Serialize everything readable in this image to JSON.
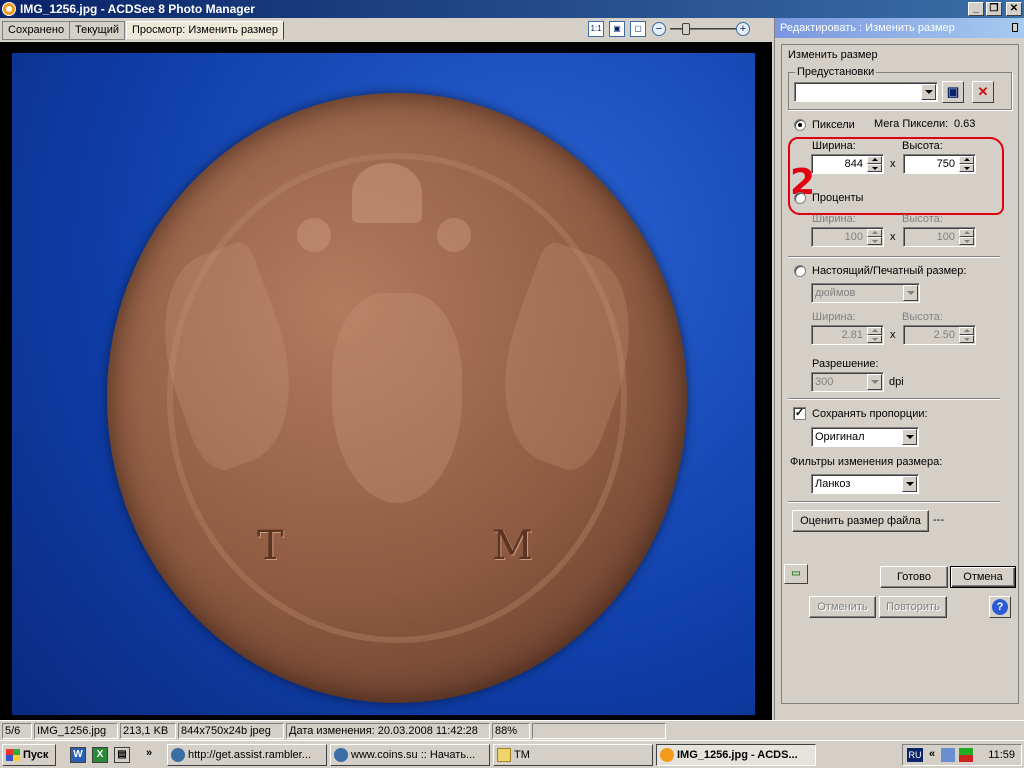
{
  "window": {
    "title": "IMG_1256.jpg - ACDSee 8 Photo Manager",
    "minimize": "_",
    "maximize": "❐",
    "close": "✕"
  },
  "tabs": [
    {
      "label": "Сохранено"
    },
    {
      "label": "Текущий"
    },
    {
      "label": "Просмотр: Изменить размер"
    }
  ],
  "viewtools": {
    "actual_size": "1:1",
    "zoom_out": "−",
    "zoom_in": "+"
  },
  "image": {
    "letter_left": "Т",
    "letter_right": "М"
  },
  "panel": {
    "title": "Редактировать : Изменить размер",
    "section": "Изменить размер",
    "presets_label": "Предустановки",
    "presets_value": "",
    "pixels_label": "Пиксели",
    "megapixels_label": "Мега Пиксели:",
    "megapixels_value": "0.63",
    "width_label": "Ширина:",
    "height_label": "Высота:",
    "px_width": "844",
    "px_height": "750",
    "x_sep": "x",
    "percent_label": "Проценты",
    "pct_width": "100",
    "pct_height": "100",
    "print_label": "Настоящий/Печатный размер:",
    "units_value": "дюймов",
    "print_width": "2.81",
    "print_height": "2.50",
    "resolution_label": "Разрешение:",
    "resolution_value": "300",
    "dpi_label": "dpi",
    "keep_ratio_label": "Сохранять пропорции:",
    "ratio_value": "Оригинал",
    "filters_label": "Фильтры изменения размера:",
    "filter_value": "Ланкоз",
    "estimate_button": "Оценить размер файла",
    "estimate_value": "---",
    "done_button": "Готово",
    "cancel_button": "Отмена",
    "undo_button": "Отменить",
    "redo_button": "Повторить",
    "help": "?",
    "annotation_number": "2"
  },
  "statusbar": {
    "index": "5/6",
    "filename": "IMG_1256.jpg",
    "filesize": "213,1 KB",
    "dimensions": "844x750x24b jpeg",
    "modified": "Дата изменения: 20.03.2008 11:42:28",
    "zoom": "88%"
  },
  "taskbar": {
    "start": "Пуск",
    "more": "»",
    "tasks": [
      {
        "label": "http://get.assist.rambler..."
      },
      {
        "label": "www.coins.su :: Начать..."
      },
      {
        "label": "TM"
      },
      {
        "label": "IMG_1256.jpg - ACDS..."
      }
    ],
    "lang": "RU",
    "tray_more": "«",
    "clock": "11:59"
  }
}
